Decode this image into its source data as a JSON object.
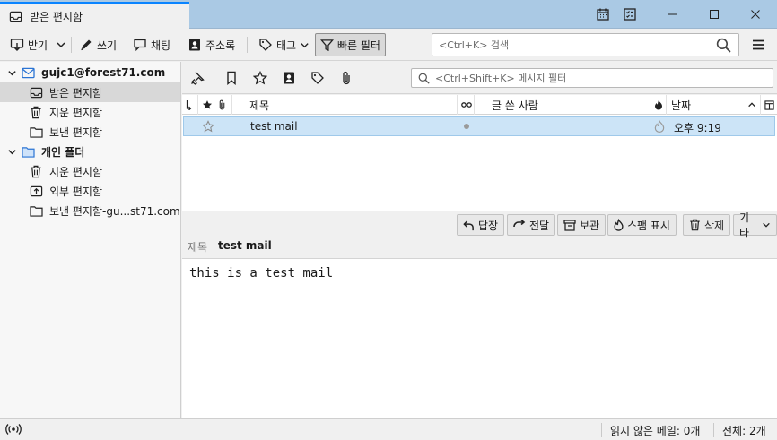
{
  "window": {
    "tab_title": "받은 편지함"
  },
  "toolbar": {
    "get_mail": "받기",
    "write": "쓰기",
    "chat": "채팅",
    "address_book": "주소록",
    "tag": "태그",
    "quick_filter": "빠른 필터",
    "search_placeholder": "<Ctrl+K> 검색"
  },
  "folders": {
    "account": "gujc1@forest71.com",
    "account_items": [
      "받은 편지함",
      "지운 편지함",
      "보낸 편지함"
    ],
    "local": "개인 폴더",
    "local_items": [
      "지운 편지함",
      "외부 편지함",
      "보낸 편지함-gu...st71.com"
    ]
  },
  "thread": {
    "filter_placeholder": "<Ctrl+Shift+K> 메시지 필터",
    "columns": {
      "subject": "제목",
      "sender": "글 쓴 사람",
      "date": "날짜"
    },
    "rows": [
      {
        "subject": "test mail",
        "sender": "",
        "date": "오후 9:19"
      }
    ]
  },
  "message": {
    "actions": {
      "reply": "답장",
      "forward": "전달",
      "archive": "보관",
      "junk": "스팸 표시",
      "delete": "삭제",
      "other": "기타"
    },
    "subject_label": "제목",
    "subject": "test mail",
    "body": "this is a test mail"
  },
  "status": {
    "unread": "읽지 않은 메일: 0개",
    "total": "전체: 2개"
  }
}
